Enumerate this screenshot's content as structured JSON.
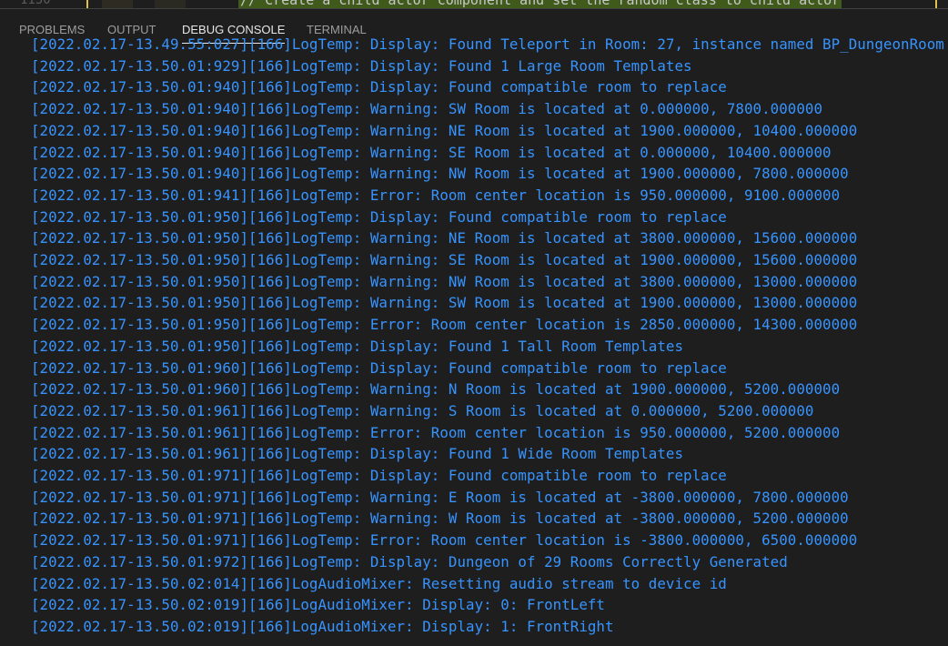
{
  "editor": {
    "line_number": "1150",
    "code_line": "// Create a child actor component and set the random class to child actor"
  },
  "panel": {
    "tabs": [
      {
        "label": "PROBLEMS"
      },
      {
        "label": "OUTPUT"
      },
      {
        "label": "DEBUG CONSOLE"
      },
      {
        "label": "TERMINAL"
      }
    ],
    "active_tab": "DEBUG CONSOLE",
    "text_color": "#3794ff"
  },
  "console": {
    "lines": [
      "[2022.02.17-13.49.55:027][166]LogTemp: Display: Found Teleport in Room: 27, instance named BP_DungeonRoom",
      "[2022.02.17-13.50.01:929][166]LogTemp: Display: Found 1 Large Room Templates",
      "[2022.02.17-13.50.01:940][166]LogTemp: Display: Found compatible room to replace",
      "[2022.02.17-13.50.01:940][166]LogTemp: Warning: SW Room is located at 0.000000, 7800.000000",
      "[2022.02.17-13.50.01:940][166]LogTemp: Warning: NE Room is located at 1900.000000, 10400.000000",
      "[2022.02.17-13.50.01:940][166]LogTemp: Warning: SE Room is located at 0.000000, 10400.000000",
      "[2022.02.17-13.50.01:940][166]LogTemp: Warning: NW Room is located at 1900.000000, 7800.000000",
      "[2022.02.17-13.50.01:941][166]LogTemp: Error: Room center location is 950.000000, 9100.000000",
      "[2022.02.17-13.50.01:950][166]LogTemp: Display: Found compatible room to replace",
      "[2022.02.17-13.50.01:950][166]LogTemp: Warning: NE Room is located at 3800.000000, 15600.000000",
      "[2022.02.17-13.50.01:950][166]LogTemp: Warning: SE Room is located at 1900.000000, 15600.000000",
      "[2022.02.17-13.50.01:950][166]LogTemp: Warning: NW Room is located at 3800.000000, 13000.000000",
      "[2022.02.17-13.50.01:950][166]LogTemp: Warning: SW Room is located at 1900.000000, 13000.000000",
      "[2022.02.17-13.50.01:950][166]LogTemp: Error: Room center location is 2850.000000, 14300.000000",
      "[2022.02.17-13.50.01:950][166]LogTemp: Display: Found 1 Tall Room Templates",
      "[2022.02.17-13.50.01:960][166]LogTemp: Display: Found compatible room to replace",
      "[2022.02.17-13.50.01:960][166]LogTemp: Warning: N Room is located at 1900.000000, 5200.000000",
      "[2022.02.17-13.50.01:961][166]LogTemp: Warning: S Room is located at 0.000000, 5200.000000",
      "[2022.02.17-13.50.01:961][166]LogTemp: Error: Room center location is 950.000000, 5200.000000",
      "[2022.02.17-13.50.01:961][166]LogTemp: Display: Found 1 Wide Room Templates",
      "[2022.02.17-13.50.01:971][166]LogTemp: Display: Found compatible room to replace",
      "[2022.02.17-13.50.01:971][166]LogTemp: Warning: E Room is located at -3800.000000, 7800.000000",
      "[2022.02.17-13.50.01:971][166]LogTemp: Warning: W Room is located at -3800.000000, 5200.000000",
      "[2022.02.17-13.50.01:971][166]LogTemp: Error: Room center location is -3800.000000, 6500.000000",
      "[2022.02.17-13.50.01:972][166]LogTemp: Display: Dungeon of 29 Rooms Correctly Generated",
      "[2022.02.17-13.50.02:014][166]LogAudioMixer: Resetting audio stream to device id",
      "[2022.02.17-13.50.02:019][166]LogAudioMixer: Display: 0: FrontLeft",
      "[2022.02.17-13.50.02:019][166]LogAudioMixer: Display: 1: FrontRight"
    ]
  }
}
